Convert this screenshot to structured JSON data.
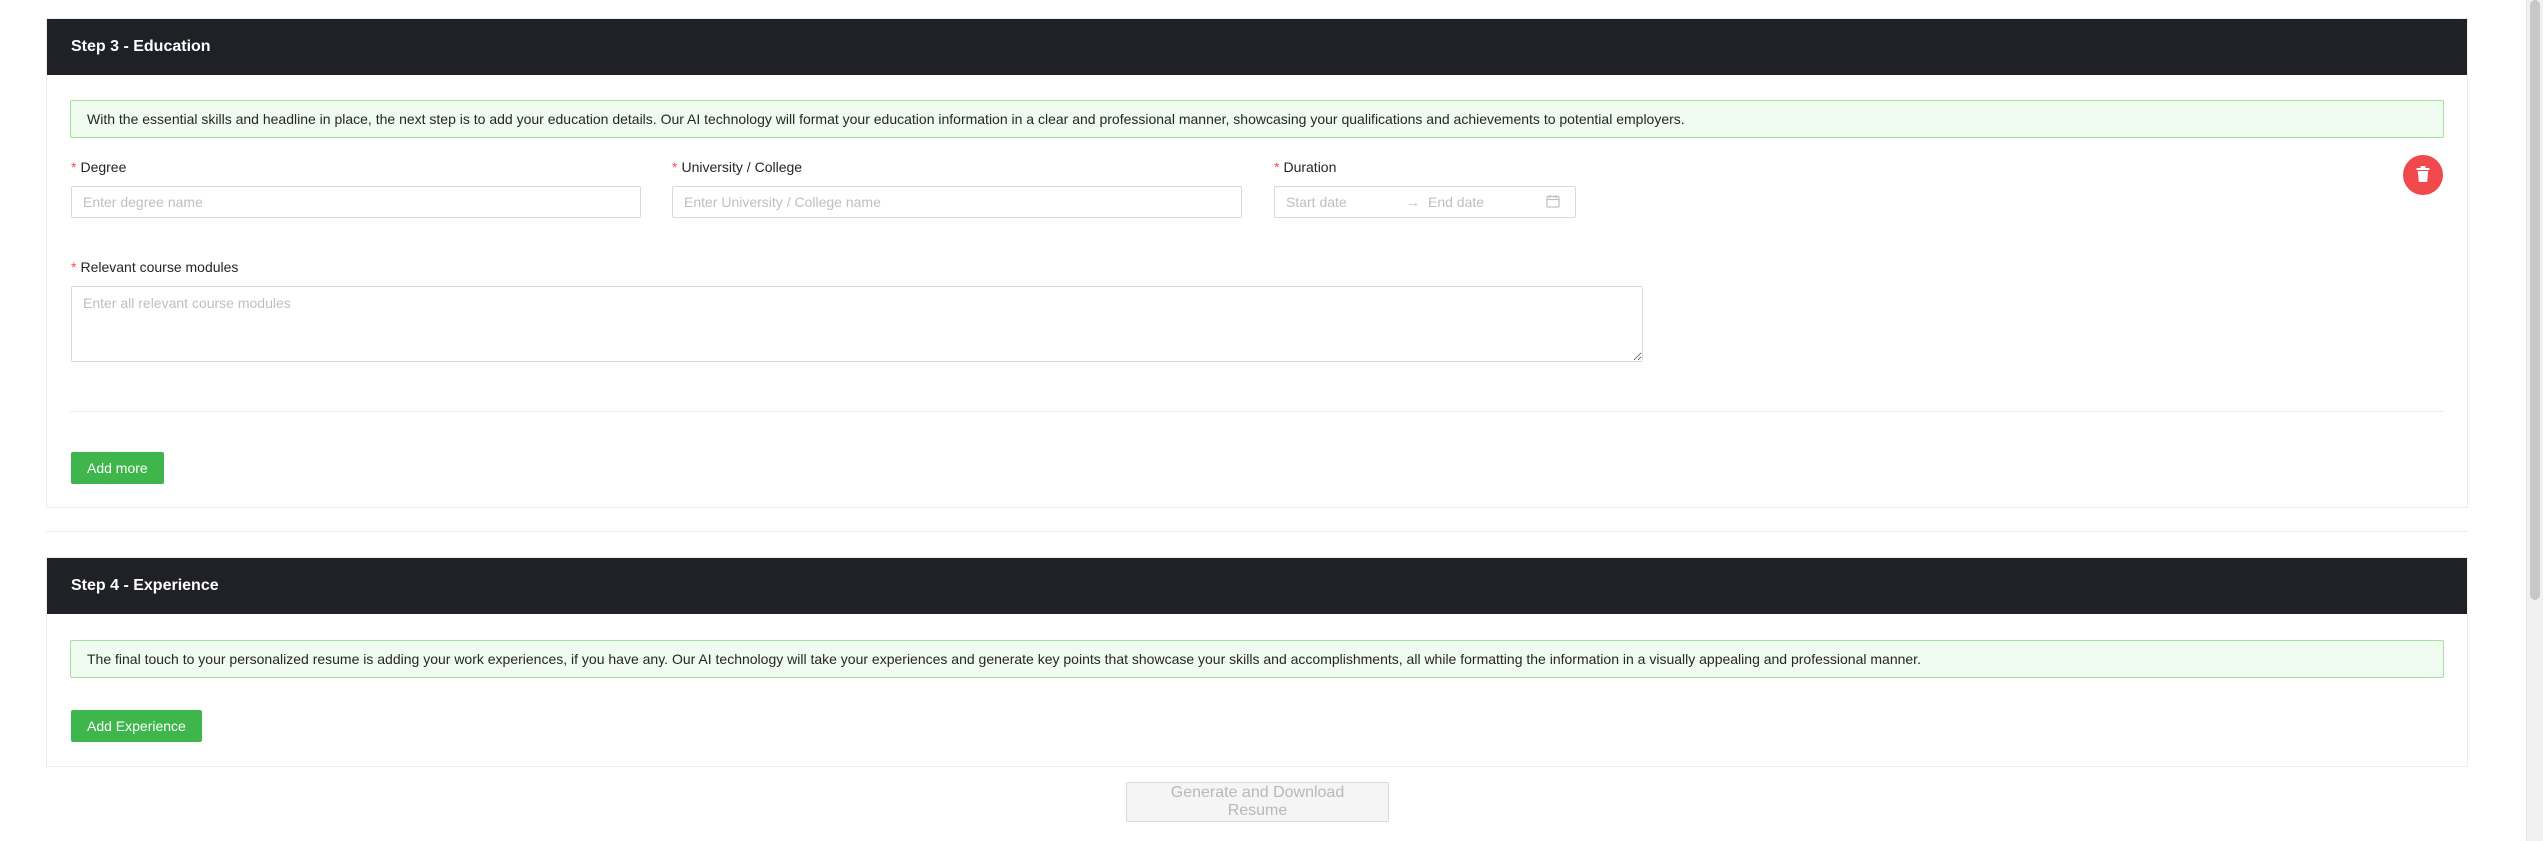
{
  "education": {
    "title": "Step 3 - Education",
    "info": "With the essential skills and headline in place, the next step is to add your education details. Our AI technology will format your education information in a clear and professional manner, showcasing your qualifications and achievements to potential employers.",
    "degree": {
      "required": "*",
      "label": "Degree",
      "placeholder": "Enter degree name"
    },
    "university": {
      "required": "*",
      "label": "University / College",
      "placeholder": "Enter University / College name"
    },
    "duration": {
      "required": "*",
      "label": "Duration",
      "start_placeholder": "Start date",
      "separator": "→",
      "end_placeholder": "End date"
    },
    "modules": {
      "required": "*",
      "label": "Relevant course modules",
      "placeholder": "Enter all relevant course modules"
    },
    "add_more_label": "Add more"
  },
  "experience": {
    "title": "Step 4 - Experience",
    "info": "The final touch to your personalized resume is adding your work experiences, if you have any. Our AI technology will take your experiences and generate key points that showcase your skills and accomplishments, all while formatting the information in a visually appealing and professional manner.",
    "add_label": "Add Experience"
  },
  "generate_label": "Generate and Download Resume",
  "colors": {
    "header_bg": "#1f2127",
    "accent_green": "#3eb64b",
    "alert_bg": "#f0fbef",
    "alert_border": "#a5dfa2",
    "danger": "#f0484b",
    "required": "#ff4d4f"
  },
  "icons": {
    "delete": "trash-icon",
    "calendar": "calendar-icon",
    "arrow": "arrow-right-icon"
  }
}
